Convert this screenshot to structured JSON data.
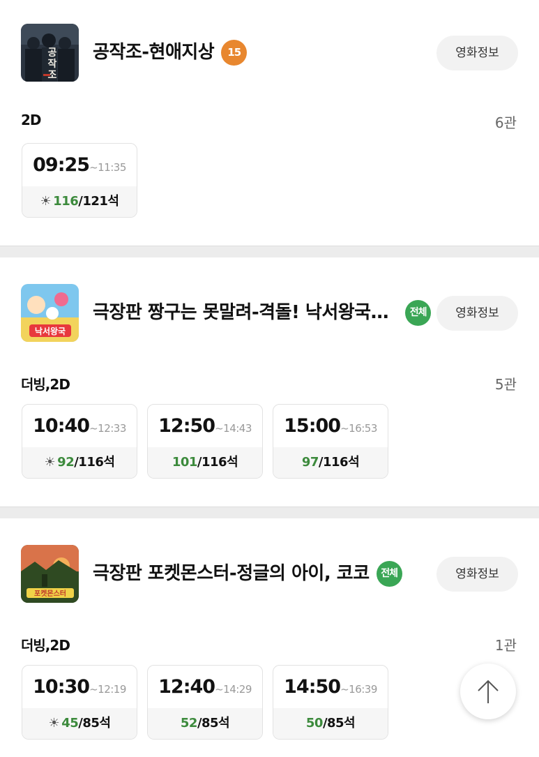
{
  "info_button_label": "영화정보",
  "movies": [
    {
      "title": "공작조-현애지상",
      "rating": "15",
      "format": "2D",
      "hall": "6관",
      "showtimes": [
        {
          "start": "09:25",
          "end": "~11:35",
          "available": "116",
          "total": "/121석",
          "morning": true
        }
      ]
    },
    {
      "title": "극장판 짱구는 못말려-격돌! 낙서왕국…",
      "rating": "전체",
      "format": "더빙,2D",
      "hall": "5관",
      "showtimes": [
        {
          "start": "10:40",
          "end": "~12:33",
          "available": "92",
          "total": "/116석",
          "morning": true
        },
        {
          "start": "12:50",
          "end": "~14:43",
          "available": "101",
          "total": "/116석",
          "morning": false
        },
        {
          "start": "15:00",
          "end": "~16:53",
          "available": "97",
          "total": "/116석",
          "morning": false
        }
      ]
    },
    {
      "title": "극장판 포켓몬스터-정글의 아이, 코코",
      "rating": "전체",
      "format": "더빙,2D",
      "hall": "1관",
      "showtimes": [
        {
          "start": "10:30",
          "end": "~12:19",
          "available": "45",
          "total": "/85석",
          "morning": true
        },
        {
          "start": "12:40",
          "end": "~14:29",
          "available": "52",
          "total": "/85석",
          "morning": false
        },
        {
          "start": "14:50",
          "end": "~16:39",
          "available": "50",
          "total": "/85석",
          "morning": false
        }
      ]
    }
  ],
  "colors": {
    "rating_15": "#e8872f",
    "rating_all": "#3aa655",
    "seats_available": "#3c8a3c"
  },
  "icons": {
    "morning": "sun-icon",
    "scroll_top": "arrow-up-icon"
  }
}
